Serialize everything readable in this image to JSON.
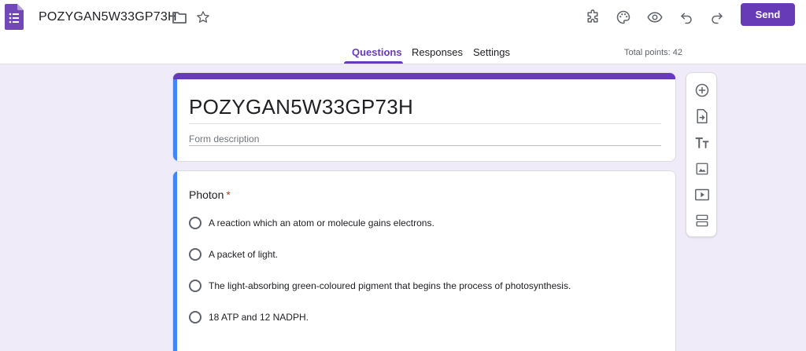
{
  "header": {
    "doc_title": "POZYGAN5W33GP73H",
    "send_label": "Send",
    "icons": [
      "forms-logo-icon",
      "folder-icon",
      "star-icon",
      "addon-puzzle-icon",
      "palette-icon",
      "preview-eye-icon",
      "undo-icon",
      "redo-icon"
    ]
  },
  "tabs": {
    "questions": "Questions",
    "responses": "Responses",
    "settings": "Settings",
    "active": "questions"
  },
  "total_points": "Total points: 42",
  "form": {
    "title": "POZYGAN5W33GP73H",
    "description_placeholder": "Form description"
  },
  "question": {
    "title": "Photon",
    "required_mark": "*",
    "options": [
      "A reaction which an atom or molecule gains electrons.",
      "A packet of light.",
      "The light-absorbing green-coloured pigment that begins the process of photosynthesis.",
      "18 ATP and 12 NADPH."
    ]
  },
  "toolbar": {
    "items": [
      "add-question-icon",
      "import-questions-icon",
      "add-title-icon",
      "add-image-icon",
      "add-video-icon",
      "add-section-icon"
    ]
  },
  "colors": {
    "accent": "#673ab7",
    "background": "#f0ebf8",
    "focus_bar": "#4285f4",
    "required": "#d93025"
  }
}
